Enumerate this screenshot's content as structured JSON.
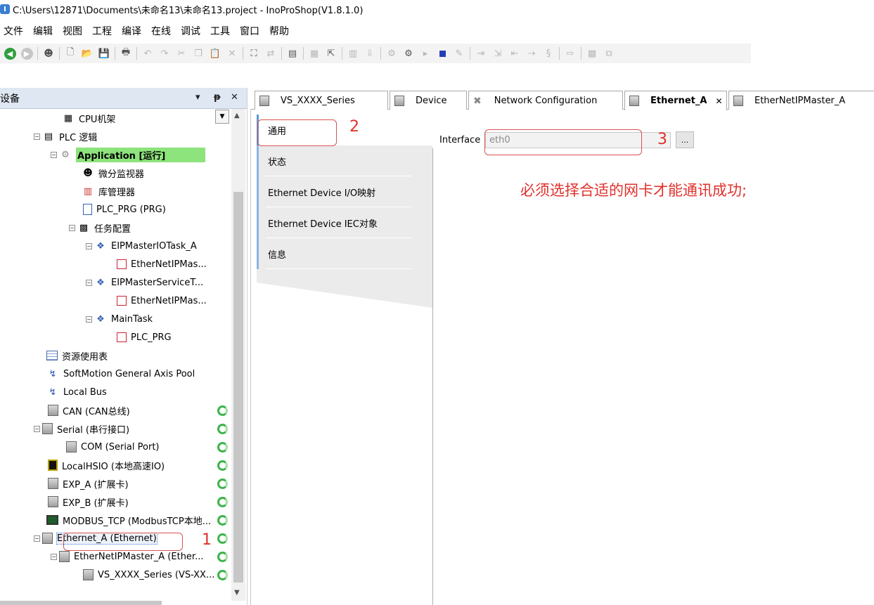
{
  "window": {
    "title": "C:\\Users\\12871\\Documents\\未命名13\\未命名13.project - InoProShop(V1.8.1.0)"
  },
  "menu": [
    "文件",
    "编辑",
    "视图",
    "工程",
    "编译",
    "在线",
    "调试",
    "工具",
    "窗口",
    "帮助"
  ],
  "left_panel": {
    "title": "设备",
    "tree": [
      {
        "label": "CPU机架",
        "icon": "rack-icon"
      },
      {
        "label": "PLC 逻辑",
        "icon": "plc-logic-icon"
      },
      {
        "label": "Application [运行]",
        "icon": "application-gear-icon"
      },
      {
        "label": "微分监视器",
        "icon": "monitor-icon"
      },
      {
        "label": "库管理器",
        "icon": "library-icon"
      },
      {
        "label": "PLC_PRG (PRG)",
        "icon": "program-icon"
      },
      {
        "label": "任务配置",
        "icon": "task-config-icon"
      },
      {
        "label": "EIPMasterIOTask_A",
        "icon": "task-icon"
      },
      {
        "label": "EtherNetIPMas...",
        "icon": "program-call-icon"
      },
      {
        "label": "EIPMasterServiceT...",
        "icon": "task-icon"
      },
      {
        "label": "EtherNetIPMas...",
        "icon": "program-call-icon"
      },
      {
        "label": "MainTask",
        "icon": "task-icon"
      },
      {
        "label": "PLC_PRG",
        "icon": "program-call-icon"
      },
      {
        "label": "资源使用表",
        "icon": "resource-table-icon"
      },
      {
        "label": "SoftMotion General Axis Pool",
        "icon": "axis-pool-icon"
      },
      {
        "label": "Local Bus",
        "icon": "local-bus-icon"
      },
      {
        "label": "CAN (CAN总线)",
        "icon": "device-icon"
      },
      {
        "label": "Serial (串行接口)",
        "icon": "device-icon"
      },
      {
        "label": "COM (Serial Port)",
        "icon": "device-icon"
      },
      {
        "label": "LocalHSIO (本地高速IO)",
        "icon": "hsio-icon"
      },
      {
        "label": "EXP_A (扩展卡)",
        "icon": "device-icon"
      },
      {
        "label": "EXP_B (扩展卡)",
        "icon": "device-icon"
      },
      {
        "label": "MODBUS_TCP (ModbusTCP本地...",
        "icon": "modbus-icon"
      },
      {
        "label": "Ethernet_A (Ethernet)",
        "icon": "device-icon"
      },
      {
        "label": "EtherNetIPMaster_A (Ether...",
        "icon": "device-icon"
      },
      {
        "label": "VS_XXXX_Series (VS-XX...",
        "icon": "device-icon"
      }
    ]
  },
  "tabs": [
    {
      "label": "VS_XXXX_Series"
    },
    {
      "label": "Device"
    },
    {
      "label": "Network Configuration"
    },
    {
      "label": "Ethernet_A"
    },
    {
      "label": "EtherNetIPMaster_A"
    }
  ],
  "editor": {
    "subtabs": [
      "通用",
      "状态",
      "Ethernet Device I/O映射",
      "Ethernet Device IEC对象",
      "信息"
    ],
    "interface_label": "Interface",
    "interface_value": "eth0",
    "browse_label": "..."
  },
  "annotations": {
    "n1": "1",
    "n2": "2",
    "n3": "3",
    "note": "必须选择合适的网卡才能通讯成功;",
    "color": "#e0312b"
  }
}
